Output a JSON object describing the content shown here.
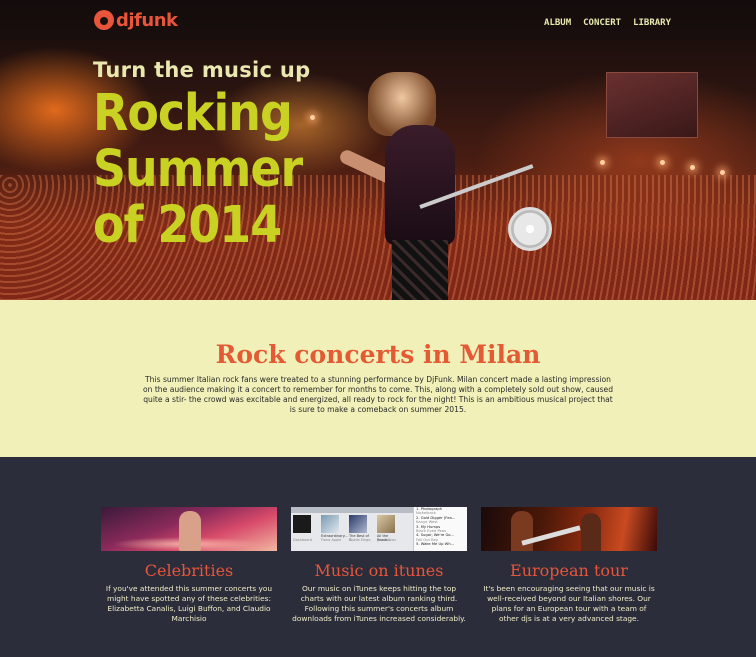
{
  "header": {
    "logo_text": "djfunk",
    "nav": [
      "ALBUM",
      "CONCERT",
      "LIBRARY"
    ]
  },
  "hero": {
    "kicker": "Turn the music up",
    "title_lines": [
      "Rocking",
      "Summer",
      "of 2014"
    ]
  },
  "about": {
    "title": "Rock concerts in Milan",
    "text": "This summer Italian rock fans were treated to a stunning performance by DjFunk. Milan concert made a lasting impression on the audience making it a concert to remember for months to come. This, along with a completely sold out show, caused quite a stir- the crowd was excitable and energized, all ready to rock for the night! This is an ambitious musical project that is sure to make a comeback on summer 2015."
  },
  "cards": [
    {
      "title": "Celebrities",
      "text": "If you've attended this summer concerts you might have spotted any of these celebrities: Elizabetta Canalis, Luigi Buffon, and Claudio Marchisio"
    },
    {
      "title": "Music on itunes",
      "text": "Our music on iTunes keeps hitting the top charts with our latest album ranking third. Following this summer's concerts album downloads from iTunes increased considerably.",
      "itunes": {
        "albums": [
          {
            "name": "",
            "artist": "Dashboard"
          },
          {
            "name": "Extraordinary...",
            "artist": "Fiona Apple"
          },
          {
            "name": "The Best of S...",
            "artist": "Sheila Elego"
          },
          {
            "name": "All the Roads...",
            "artist": "Jason Mraz"
          }
        ],
        "chart": [
          {
            "num": "1.",
            "title": "Photograph",
            "artist": "Nickelback"
          },
          {
            "num": "2.",
            "title": "Gold Digger (Fea...",
            "artist": "Kanye West"
          },
          {
            "num": "3.",
            "title": "My Humps",
            "artist": "Black Eyed Peas"
          },
          {
            "num": "4.",
            "title": "Sugar, We're Go...",
            "artist": "Fall Out Boy"
          },
          {
            "num": "5.",
            "title": "Wake Me Up Wh...",
            "artist": ""
          }
        ]
      }
    },
    {
      "title": "European tour",
      "text": "It's been encouraging seeing that our music is well-received beyond our Italian shores. Our plans for an European tour with a team of other djs is at a very advanced stage."
    }
  ],
  "colors": {
    "accent": "#e8553a",
    "hero_title": "#c9d223",
    "about_bg": "#f0f0b8",
    "dark_bg": "#2b2d3b"
  }
}
